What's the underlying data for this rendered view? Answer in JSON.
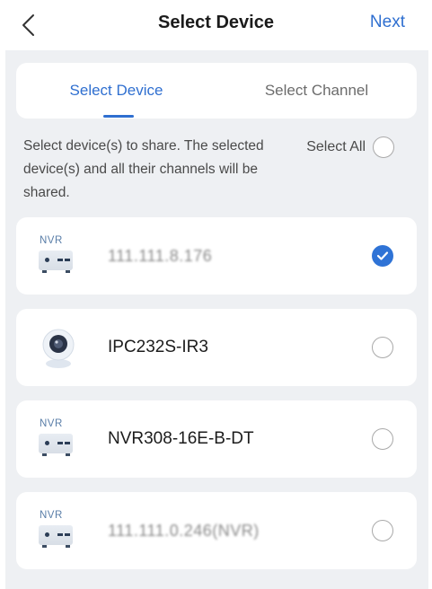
{
  "header": {
    "title": "Select Device",
    "next_label": "Next"
  },
  "tabs": [
    {
      "label": "Select Device",
      "active": true
    },
    {
      "label": "Select Channel",
      "active": false
    }
  ],
  "description": "Select device(s) to share. The selected device(s) and all their channels will be shared.",
  "select_all": {
    "label": "Select All",
    "checked": false
  },
  "devices": [
    {
      "name": "111.111.8.176",
      "icon": "nvr-icon",
      "checked": true,
      "obscured": true
    },
    {
      "name": "IPC232S-IR3",
      "icon": "camera-icon",
      "checked": false,
      "obscured": false
    },
    {
      "name": "NVR308-16E-B-DT",
      "icon": "nvr-icon",
      "checked": false,
      "obscured": false
    },
    {
      "name": "111.111.0.246(NVR)",
      "icon": "nvr-icon",
      "checked": false,
      "obscured": true
    }
  ],
  "icons": {
    "nvr_text": "NVR"
  },
  "colors": {
    "accent": "#2f6fd0",
    "background": "#eef0f3",
    "card": "#ffffff"
  }
}
